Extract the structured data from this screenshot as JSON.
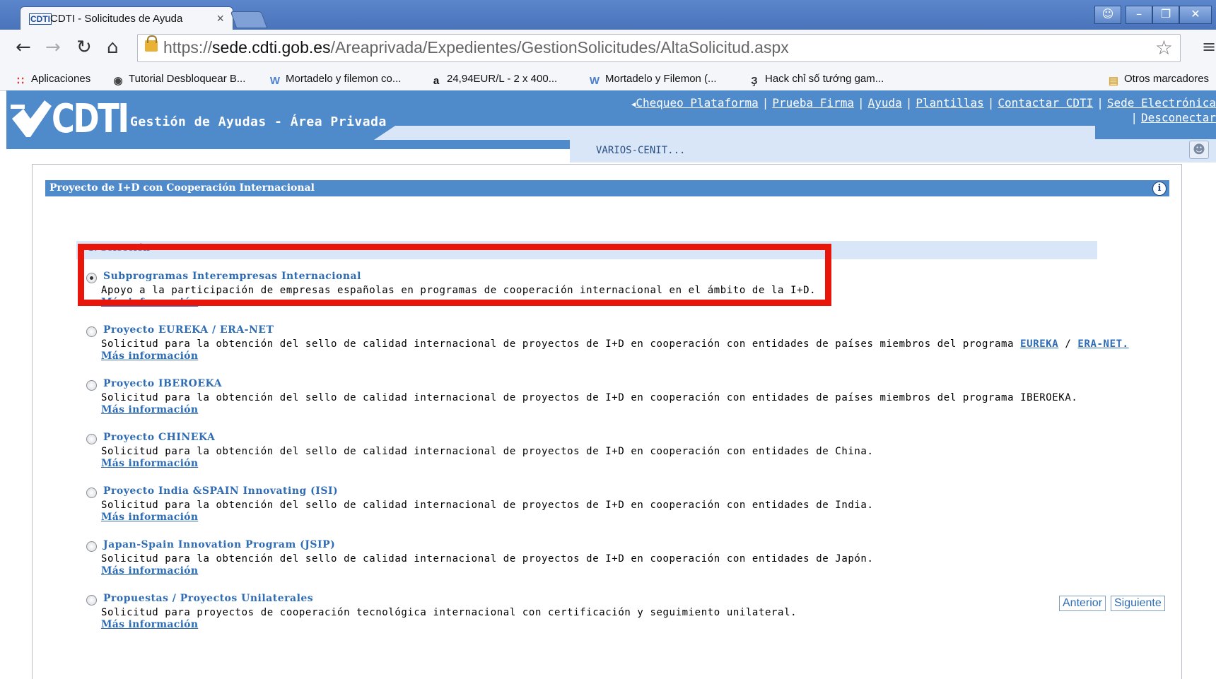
{
  "browser": {
    "tab_title": "CDTI - Solicitudes de Ayuda",
    "tab_close": "×",
    "url_scheme": "https://",
    "url_host": "sede.cdti.gob.es",
    "url_path": "/Areaprivada/Expedientes/GestionSolicitudes/AltaSolicitud.aspx",
    "bookmarks": [
      {
        "label": "Aplicaciones",
        "icon": "apps-grid-icon"
      },
      {
        "label": "Tutorial Desbloquear B...",
        "icon": "globe-icon"
      },
      {
        "label": "Mortadelo y filemon co...",
        "icon": "w-logo-icon"
      },
      {
        "label": "24,94EUR/L - 2 x 400...",
        "icon": "amazon-icon"
      },
      {
        "label": "Mortadelo y Filemon (...",
        "icon": "w-logo-icon"
      },
      {
        "label": "Hack chỉ số tướng gam...",
        "icon": "hack-icon"
      }
    ],
    "other_bookmarks": "Otros marcadores"
  },
  "site": {
    "logo_text": "CDTI",
    "app_title": "Gestión de Ayudas - Área Privada",
    "top_links": [
      "Chequeo Plataforma",
      "Prueba Firma",
      "Ayuda",
      "Plantillas",
      "Contactar CDTI",
      "Sede Electrónica"
    ],
    "disconnect": "Desconectar",
    "user": "VARIOS-CENIT..."
  },
  "panel": {
    "title": "Proyecto de I+D con Cooperación Internacional",
    "section_title": "1. Selección",
    "options": [
      {
        "label": "Subprogramas Interempresas Internacional",
        "desc": "Apoyo a la participación de empresas españolas en programas de cooperación internacional en el ámbito de la I+D.",
        "more": "Más información",
        "selected": true
      },
      {
        "label": "Proyecto EUREKA / ERA-NET",
        "desc_pre": "Solicitud para la obtención del sello de calidad internacional de proyectos de I+D en cooperación con entidades de países miembros del programa ",
        "link1": "EUREKA",
        "slash": " / ",
        "link2": "ERA-NET.",
        "more": "Más información",
        "selected": false
      },
      {
        "label": "Proyecto IBEROEKA",
        "desc": "Solicitud para la obtención del sello de calidad internacional de proyectos de I+D en cooperación con entidades de países miembros del programa IBEROEKA.",
        "more": "Más información",
        "selected": false
      },
      {
        "label": "Proyecto CHINEKA",
        "desc": "Solicitud para la obtención del sello de calidad internacional de proyectos de I+D en cooperación con entidades de China.",
        "more": "Más información",
        "selected": false
      },
      {
        "label": "Proyecto India &SPAIN Innovating (ISI)",
        "desc": "Solicitud para la obtención del sello de calidad internacional de proyectos de I+D en cooperación con entidades de India.",
        "more": "Más información",
        "selected": false
      },
      {
        "label": "Japan-Spain Innovation Program (JSIP)",
        "desc": "Solicitud para la obtención del sello de calidad internacional de proyectos de I+D en cooperación con entidades de Japón.",
        "more": "Más información",
        "selected": false
      },
      {
        "label": "Propuestas / Proyectos Unilaterales",
        "desc": "Solicitud para proyectos de cooperación tecnológica internacional con certificación y seguimiento unilateral.",
        "more": "Más información",
        "selected": false
      }
    ],
    "prev_button": "Anterior",
    "next_button": "Siguiente"
  },
  "colors": {
    "header_blue": "#4f8acb",
    "link_blue": "#2e6cb5",
    "highlight_red": "#e8150a",
    "light_blue": "#d8e6f7"
  }
}
